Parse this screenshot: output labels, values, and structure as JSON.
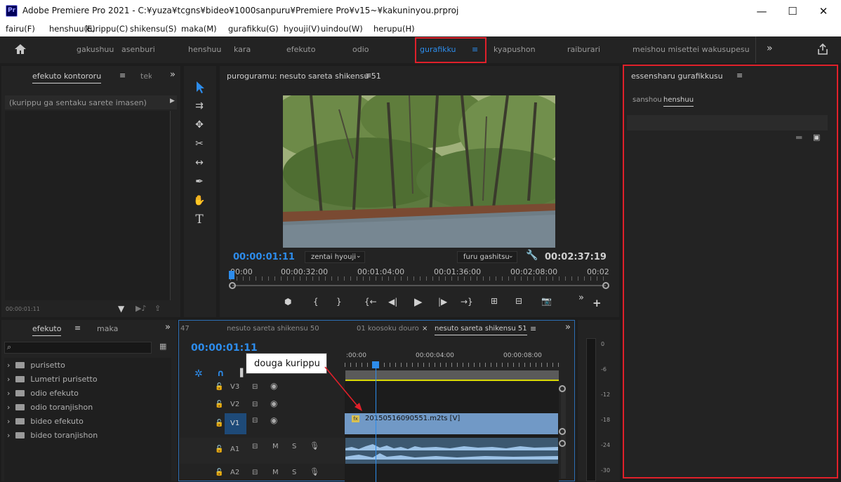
{
  "window": {
    "title": "Adobe Premiere Pro 2021 - C:¥yuza¥tcgns¥bideo¥1000sanpuru¥Premiere Pro¥v15~¥kakuninyou.prproj",
    "app_badge": "Pr",
    "minimize": "—",
    "maximize": "☐",
    "close": "✕"
  },
  "menu": [
    "fairu(F)",
    "henshuu(E)",
    "kurippu(C)",
    "shikensu(S)",
    "maka(M)",
    "gurafikku(G)",
    "hyouji(V)",
    "uindou(W)",
    "herupu(H)"
  ],
  "workspaces": {
    "items": [
      "gakushuu",
      "asenburi",
      "henshuu",
      "kara",
      "efekuto",
      "odio",
      "gurafikku",
      "kyapushon",
      "raiburari",
      "meishou misettei wakusupesu"
    ],
    "active": "gurafikku",
    "more": "»"
  },
  "effect_controls": {
    "tab": "efekuto kontororu",
    "tab2": "tekisuto",
    "more": "»",
    "message": "(kurippu ga sentaku sarete imasen)",
    "timecode": "00:00:01:11"
  },
  "program": {
    "title": "puroguramu: nesuto sareta shikensu 51",
    "timecode": "00:00:01:11",
    "zoom": "zentai hyouji",
    "quality": "furu gashitsu",
    "duration": "00:02:37:19",
    "ruler": [
      "00:00",
      "00:00:32:00",
      "00:01:04:00",
      "00:01:36:00",
      "00:02:08:00",
      "00:02"
    ],
    "buttons": {
      "marker": "marker",
      "in": "{",
      "out": "}",
      "goto_in": "{←",
      "step_back": "◀|",
      "play": "▶",
      "step_fwd": "|▶",
      "goto_out": "→}",
      "lift": "lift",
      "extract": "extract",
      "camera": "camera",
      "more": "»",
      "add": "+"
    }
  },
  "essential_graphics": {
    "title": "essensharu gurafikkusu",
    "tabs": [
      "sanshou",
      "henshuu"
    ],
    "active_tab": "henshuu"
  },
  "effects": {
    "tab": "efekuto",
    "tab2": "maka",
    "more": "»",
    "items": [
      "purisetto",
      "Lumetri purisetto",
      "odio efekuto",
      "odio toranjishon",
      "bideo efekuto",
      "bideo toranjishon"
    ]
  },
  "timeline": {
    "tabs": [
      "47",
      "nesuto sareta shikensu 50",
      "01 koosoku douro",
      "nesuto sareta shikensu 51"
    ],
    "active_tab": "nesuto sareta shikensu 51",
    "close": "×",
    "more": "»",
    "timecode": "00:00:01:11",
    "ruler": [
      ":00:00",
      "00:00:04:00",
      "00:00:08:00"
    ],
    "tracks": [
      {
        "name": "V3",
        "type": "video"
      },
      {
        "name": "V2",
        "type": "video"
      },
      {
        "name": "V1",
        "type": "video"
      },
      {
        "name": "A1",
        "type": "audio",
        "m": "M",
        "s": "S"
      },
      {
        "name": "A2",
        "type": "audio",
        "m": "M",
        "s": "S"
      }
    ],
    "clip_name": "20150516090551.m2ts [V]",
    "fx": "fx",
    "audio_ch": "2",
    "callout": "douga kurippu"
  },
  "meter": {
    "scale": [
      "0",
      "-6",
      "-12",
      "-18",
      "-24",
      "-30"
    ]
  },
  "colors": {
    "accent": "#2d8ceb",
    "highlight": "#e0202a",
    "clip": "#7199c6",
    "audio_clip": "#4a6a8a"
  }
}
